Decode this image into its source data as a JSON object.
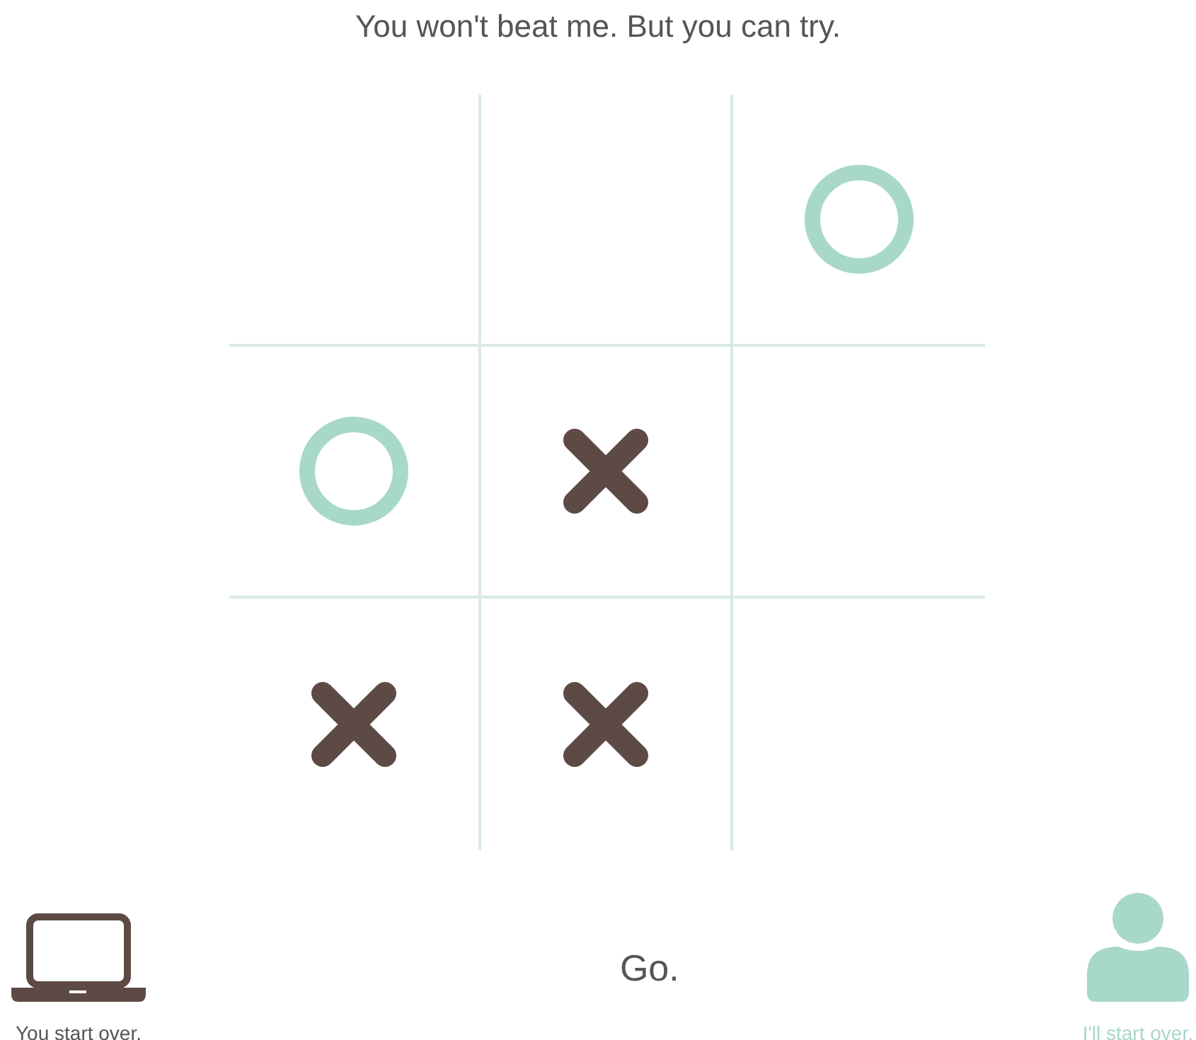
{
  "title": "You won't beat me. But you can try.",
  "board": [
    {
      "kind": "empty"
    },
    {
      "kind": "empty"
    },
    {
      "kind": "o"
    },
    {
      "kind": "o"
    },
    {
      "kind": "x"
    },
    {
      "kind": "empty"
    },
    {
      "kind": "x"
    },
    {
      "kind": "x"
    },
    {
      "kind": "empty"
    }
  ],
  "status": "Go.",
  "players": [
    {
      "kind": "computer",
      "label": "You start over.",
      "color": "#5e4a45",
      "selected": false
    },
    {
      "kind": "person",
      "label": "I'll start over.",
      "color": "#a8d8c8",
      "selected": true
    }
  ]
}
